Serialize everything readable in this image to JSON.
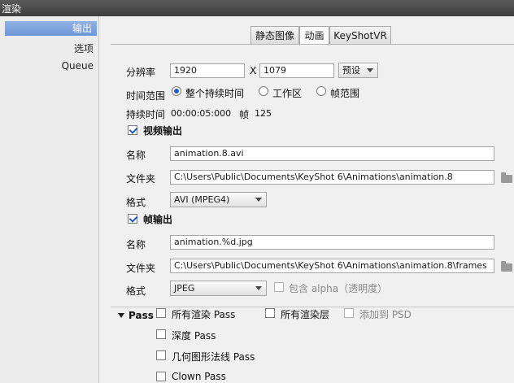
{
  "window": {
    "title": "渲染"
  },
  "sidebar": {
    "items": [
      {
        "label": "输出"
      },
      {
        "label": "选项"
      },
      {
        "label": "Queue"
      }
    ]
  },
  "tabs": [
    {
      "label": "静态图像"
    },
    {
      "label": "动画"
    },
    {
      "label": "KeyShotVR"
    }
  ],
  "resolution": {
    "label": "分辨率",
    "width": "1920",
    "x": "X",
    "height": "1079",
    "preset": "预设"
  },
  "time_range": {
    "label": "时间范围",
    "options": [
      "整个持续时间",
      "工作区",
      "帧范围"
    ]
  },
  "duration": {
    "label": "持续时间",
    "value": "00:00:05:000",
    "frames_label": "帧",
    "frames": "125"
  },
  "video_output": {
    "label": "视频输出",
    "name_label": "名称",
    "name": "animation.8.avi",
    "folder_label": "文件夹",
    "folder": "C:\\Users\\Public\\Documents\\KeyShot 6\\Animations\\animation.8",
    "format_label": "格式",
    "format": "AVI (MPEG4)"
  },
  "frame_output": {
    "label": "帧输出",
    "name_label": "名称",
    "name": "animation.%d.jpg",
    "folder_label": "文件夹",
    "folder": "C:\\Users\\Public\\Documents\\KeyShot 6\\Animations\\animation.8\\frames",
    "format_label": "格式",
    "format": "JPEG",
    "alpha_label": "包含 alpha（透明度）"
  },
  "pass": {
    "label": "Pass",
    "all_render": "所有渲染 Pass",
    "all_layers": "所有渲染层",
    "add_psd": "添加到 PSD",
    "depth": "深度 Pass",
    "normals": "几何图形法线 Pass",
    "clown": "Clown Pass"
  }
}
